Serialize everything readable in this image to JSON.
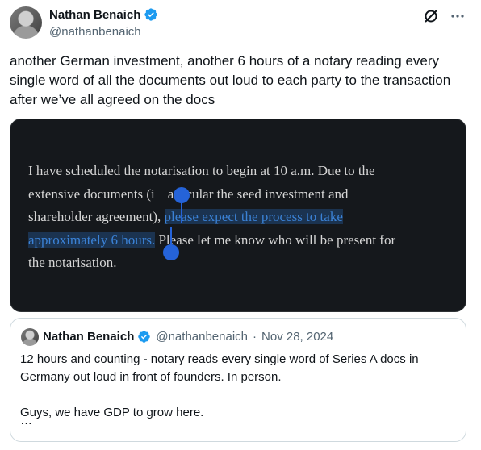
{
  "author": {
    "name": "Nathan Benaich",
    "handle": "@nathanbenaich",
    "avatar_icon": "avatar-photo",
    "verified_icon": "verified-badge-icon"
  },
  "header_icons": [
    "grok-icon",
    "more-options-icon"
  ],
  "tweet": {
    "text": "another German investment, another 6 hours of a notary reading every single word of all the documents out loud to each party to the transaction after we’ve all agreed on the docs"
  },
  "media": {
    "line1": "I have scheduled the notarisation to begin at 10 a.m. Due to the",
    "line2a": "extensive documents (i",
    "line2b": "articular the seed investment and",
    "line3a": "shareholder agreement), ",
    "line3b": "please expect the process to take",
    "line4a": "approximately 6 hours.",
    "line4b": " Please let me know who will be present for",
    "line5": "the notarisation.",
    "highlight_color": "#1b3350"
  },
  "quote": {
    "name": "Nathan Benaich",
    "handle": "@nathanbenaich",
    "separator": "·",
    "date": "Nov 28, 2024",
    "para1": "12 hours and counting - notary reads every single word of Series A docs in Germany out loud in front of founders. In person.",
    "para2": "Guys, we have GDP to grow here.",
    "ellipsis": "…"
  },
  "colors": {
    "accent": "#1d9bf0",
    "secondary_text": "#536471",
    "selection_handle": "#2563d9"
  }
}
